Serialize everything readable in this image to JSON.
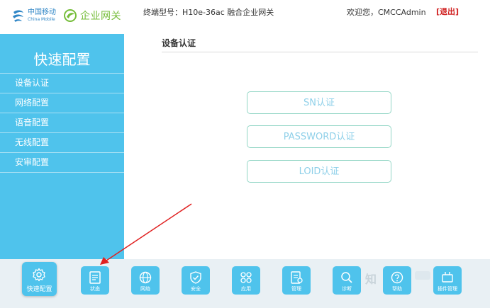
{
  "logo": {
    "china_mobile_cn": "中国移动",
    "china_mobile_en": "China Mobile",
    "enterprise_gateway": "企业网关"
  },
  "header": {
    "model": "终端型号：H10e-36ac 融合企业网关",
    "welcome": "欢迎您，CMCCAdmin",
    "logout": "[退出]"
  },
  "sidebar": {
    "title": "快速配置",
    "items": [
      {
        "label": "设备认证"
      },
      {
        "label": "网络配置"
      },
      {
        "label": "语音配置"
      },
      {
        "label": "无线配置"
      },
      {
        "label": "安审配置"
      }
    ]
  },
  "main": {
    "section_title": "设备认证",
    "buttons": [
      {
        "label": "SN认证"
      },
      {
        "label": "PASSWORD认证"
      },
      {
        "label": "LOID认证"
      }
    ]
  },
  "toolbar": {
    "active": {
      "label": "快速配置",
      "icon": "gear-icon"
    },
    "items": [
      {
        "label": "状态",
        "icon": "status-icon"
      },
      {
        "label": "网络",
        "icon": "globe-icon"
      },
      {
        "label": "安全",
        "icon": "shield-icon"
      },
      {
        "label": "应用",
        "icon": "apps-icon"
      },
      {
        "label": "管理",
        "icon": "manage-icon"
      },
      {
        "label": "诊断",
        "icon": "search-icon"
      },
      {
        "label": "帮助",
        "icon": "help-icon"
      },
      {
        "label": "插件管理",
        "icon": "plugin-icon"
      }
    ]
  },
  "watermark": "知",
  "colors": {
    "accent": "#4fc3ec",
    "button_border": "#92d6c5",
    "button_text": "#8fd0e9",
    "logout": "#d02020",
    "arrow": "#e02020"
  }
}
